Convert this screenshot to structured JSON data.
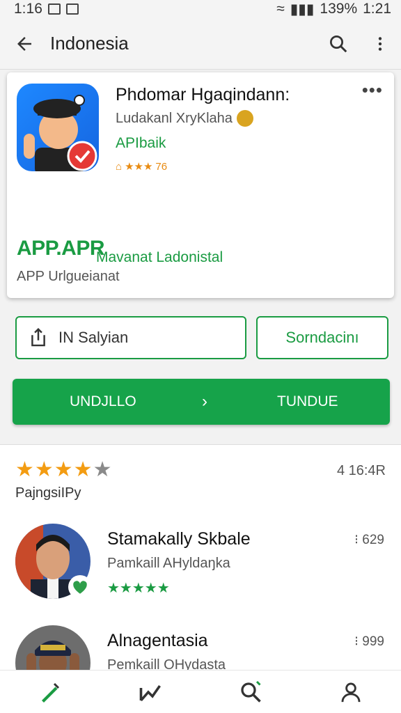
{
  "status_bar": {
    "time": "1:16",
    "battery": "139%",
    "clock": "1:21"
  },
  "app_bar": {
    "title": "Indonesia",
    "icons": [
      "back-arrow-icon",
      "search-icon",
      "more-vert-icon"
    ]
  },
  "app_card": {
    "title": "Phdomar Hgaqindann:",
    "developer": "Ludakanl XryKlaha",
    "category": "APIbaik",
    "rating_stars": "★★★",
    "rating_suffix": "76",
    "promo_big": "APP.APR",
    "promo_small": "Mavanat Ladonistal",
    "promo_sub": "APP Urlgueianat"
  },
  "actions": {
    "share_label": "IN Salyian",
    "recommend_label": "Sorndacinı",
    "install_left": "UNDJLLO",
    "install_arrow": "›",
    "install_right": "TUNDUE"
  },
  "reviews": {
    "overall_stars_on": "★★★★",
    "overall_stars_off": "★",
    "overall_count": "4 16:4R",
    "label": "PajngsiIPy",
    "items": [
      {
        "name": "Stamakally Skbale",
        "meta": "Pamkaill AHyldaŋka",
        "stars": "★★★★★",
        "score": "⁝ 629"
      },
      {
        "name": "Alnagentasia",
        "meta": "Pemkaill OHydasta",
        "stars": "★★★★",
        "score": "⁝ 999"
      }
    ]
  },
  "colors": {
    "accent_green": "#16a34a",
    "text_green": "#1a9b42",
    "star_orange": "#f39c12"
  }
}
